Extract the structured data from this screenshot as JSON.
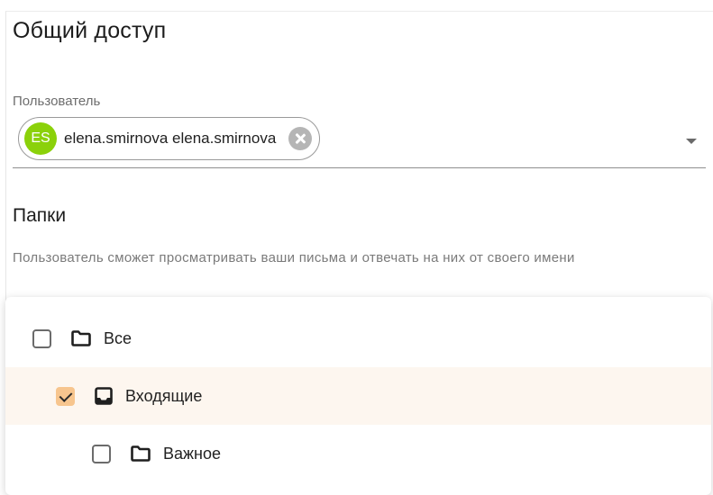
{
  "title": "Общий доступ",
  "user_field": {
    "label": "Пользователь",
    "chip": {
      "initials": "ES",
      "text": "elena.smirnova elena.smirnova"
    }
  },
  "folders_section": {
    "title": "Папки",
    "description": "Пользователь сможет просматривать ваши письма и отвечать на них от своего имени",
    "items": [
      {
        "label": "Все",
        "checked": false,
        "icon": "folder-icon"
      },
      {
        "label": "Входящие",
        "checked": true,
        "icon": "inbox-icon"
      },
      {
        "label": "Важное",
        "checked": false,
        "icon": "folder-icon"
      }
    ]
  },
  "colors": {
    "avatar": "#8bd10a",
    "checked_checkbox": "#f7c58e",
    "selected_row": "#fdf6ef"
  }
}
